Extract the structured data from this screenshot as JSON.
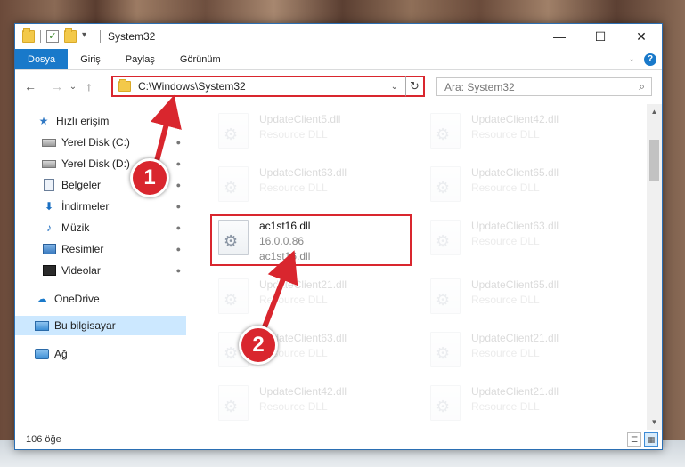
{
  "window": {
    "title": "System32",
    "controls": {
      "minimize": "—",
      "maximize": "☐",
      "close": "✕"
    }
  },
  "ribbon": {
    "tabs": [
      "Dosya",
      "Giriş",
      "Paylaş",
      "Görünüm"
    ],
    "help": "?",
    "collapse": "⌄"
  },
  "nav": {
    "back": "←",
    "forward": "→",
    "recent": "⌄",
    "up": "↑"
  },
  "address": {
    "path": "C:\\Windows\\System32",
    "dropdown": "⌄",
    "refresh": "↻"
  },
  "search": {
    "placeholder": "Ara: System32",
    "icon": "⌕"
  },
  "sidebar": {
    "items": [
      {
        "label": "Hızlı erişim",
        "icon": "star-icon",
        "pinned": false
      },
      {
        "label": "Yerel Disk (C:)",
        "icon": "drive-icon",
        "pinned": true
      },
      {
        "label": "Yerel Disk (D:)",
        "icon": "drive-icon",
        "pinned": true
      },
      {
        "label": "Belgeler",
        "icon": "document-icon",
        "pinned": true
      },
      {
        "label": "İndirmeler",
        "icon": "download-icon",
        "pinned": true
      },
      {
        "label": "Müzik",
        "icon": "music-icon",
        "pinned": true
      },
      {
        "label": "Resimler",
        "icon": "pictures-icon",
        "pinned": true
      },
      {
        "label": "Videolar",
        "icon": "video-icon",
        "pinned": true
      },
      {
        "label": "OneDrive",
        "icon": "cloud-icon",
        "pinned": false
      },
      {
        "label": "Bu bilgisayar",
        "icon": "computer-icon",
        "pinned": false,
        "selected": true
      },
      {
        "label": "Ağ",
        "icon": "network-icon",
        "pinned": false
      }
    ],
    "pin_glyph": "📌"
  },
  "files": {
    "left": [
      {
        "name": "UpdateClient5.dll",
        "type": "Resource DLL"
      },
      {
        "name": "UpdateClient63.dll",
        "type": "Resource DLL"
      },
      {
        "name": "ac1st16.dll",
        "version": "16.0.0.86",
        "desc": "ac1st16.dll",
        "highlight": true
      },
      {
        "name": "UpdateClient21.dll",
        "type": "Resource DLL"
      },
      {
        "name": "UpdateClient63.dll",
        "type": "Resource DLL"
      },
      {
        "name": "UpdateClient42.dll",
        "type": "Resource DLL"
      }
    ],
    "right": [
      {
        "name": "UpdateClient42.dll",
        "type": "Resource DLL"
      },
      {
        "name": "UpdateClient65.dll",
        "type": "Resource DLL"
      },
      {
        "name": "UpdateClient63.dll",
        "type": "Resource DLL"
      },
      {
        "name": "UpdateClient65.dll",
        "type": "Resource DLL"
      },
      {
        "name": "UpdateClient21.dll",
        "type": "Resource DLL"
      },
      {
        "name": "UpdateClient21.dll",
        "type": "Resource DLL"
      }
    ]
  },
  "status": {
    "count": "106 öğe"
  },
  "annotations": {
    "step1": "1",
    "step2": "2"
  },
  "colors": {
    "accent": "#1979ca",
    "highlight_border": "#d9262e",
    "selected_bg": "#cce8ff"
  }
}
